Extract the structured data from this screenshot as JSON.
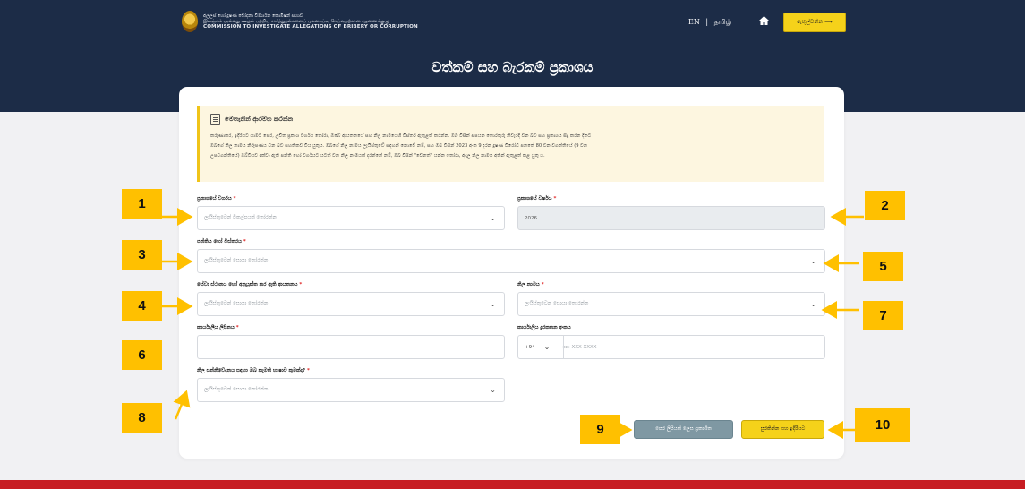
{
  "header": {
    "logo_line_si": "අල්ලස් හෝ දූෂණ චෝදනා විමර්ශන කොමිෂන් සභාව",
    "logo_line_ta": "இலஞ்சம் அல்லது ஊழல் பற்றிய சார்த்துதல்களைப் புலனாய்வு செய்வதற்கான ஆணைக்குழு",
    "logo_line_en": "COMMISSION TO INVESTIGATE ALLEGATIONS OF BRIBERY OR CORRUPTION",
    "lang_en": "EN",
    "lang_sep": "|",
    "lang_ta": "தமிழ்",
    "login_label": "ඇතුල්වන්න ⟶",
    "page_title": "වත්කම් සහ බැරකම් ප්‍රකාශය"
  },
  "notice": {
    "title": "මෙතැනින් ආරම්භ කරන්න",
    "line1": "කරුණාකර, ඉදිරියට යාමට පෙර, උචිත ප්‍රකාශ වර්ගය තෝරා, ඔබේ ආයතනයේ සහ නිල නාමයෙහි විස්තර ඇතුළත් කරන්න. ඔබ විසින් සපයන තොරතුරු නිවැරදි වන බව සහ ප්‍රකාශය සිදු කරන දිනට",
    "line2": "ඔබගේ නිල නාමය නිරූපණය වන බව සහතිකව විය යුතුය. ඔබගේ නිල නාමය ලැයිස්තුවේ සඳහන් නොවේ නම්, සහ ඔබ විසින් 2023 අංක 9 දරන දූෂණ විරෝධී පනතේ 80 වන වගන්තියේ (9 වන",
    "line3": "උපවගන්තියේ) ඔබ්වියව දක්වා ඇති පන්ති හෝ වර්ගයට යටත් වන නිල නාමයක් දරන්නේ නම්, ඔබ විසින් \"වෙනත්\" යන්න තෝරා, අදාල නිල නාමය අතින් ඇතුළත් කළ යුතු ය."
  },
  "form": {
    "declaration_type": {
      "label": "ප්‍රකාශයේ වර්ගය",
      "placeholder": "ලැයිස්තුවෙන් විකල්පයක් තෝරන්න"
    },
    "declaration_year": {
      "label": "ප්‍රකාශයේ වර්ෂය",
      "value": "2026"
    },
    "class_category": {
      "label": "පන්තිය හෝ විස්තරය",
      "placeholder": "ලැයිස්තුවෙන් සොයා තෝරන්න"
    },
    "institution": {
      "label": "සේවා ස්ථානය හෝ අනුයුක්ත කර ඇති ආයතනය",
      "placeholder": "ලැයිස්තුවෙන් සොයා තෝරන්න"
    },
    "designation": {
      "label": "නිල නාමය",
      "placeholder": "ලැයිස්තුවෙන් සොයා තෝරන්න"
    },
    "office_address": {
      "label": "කාර්යාලීය ලිපිනය",
      "value": ""
    },
    "office_phone": {
      "label": "කාර්යාලීය දුරකතන අංකය",
      "country_code": "+94",
      "placeholder": "ex: XXX XXXX"
    },
    "communication_language": {
      "label": "නිල සන්නිවේදනය සඳහා ඔබ කැමති භාෂාව කුමක්ද?",
      "placeholder": "ලැයිස්තුවෙන් සොයා තෝරන්න"
    },
    "required_mark": "*"
  },
  "buttons": {
    "previous_declarations": "පෙර ලිපියක් ලෙස ප්‍රකාශිත",
    "save_continue": "සුරකින්න සහ ඉදිරියට"
  },
  "callouts": [
    "1",
    "2",
    "3",
    "4",
    "5",
    "6",
    "7",
    "8",
    "9",
    "10"
  ],
  "colors": {
    "header_bg": "#1c2c47",
    "accent_yellow": "#f5d21a",
    "callout_orange": "#ffc000",
    "footer_red": "#c71c22",
    "button_gray": "#7f98a3"
  }
}
